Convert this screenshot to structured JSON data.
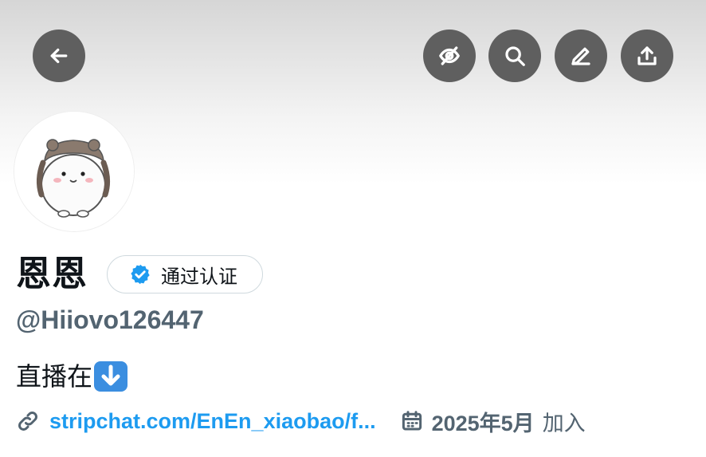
{
  "profile": {
    "display_name": "恩恩",
    "verified_label": "通过认证",
    "handle": "@Hiiovo126447",
    "bio": "直播在",
    "bio_emoji": "down-arrow-emoji",
    "link": "stripchat.com/EnEn_xiaobao/f...",
    "join_date": "2025年5月",
    "join_suffix": "加入"
  },
  "header": {
    "buttons": [
      "back-icon",
      "hide-icon",
      "search-icon",
      "edit-icon",
      "share-icon"
    ]
  },
  "colors": {
    "accent": "#1d9bf0",
    "muted_text": "#536471",
    "button_bg": "#5f5f5f",
    "text": "#0f1419"
  }
}
